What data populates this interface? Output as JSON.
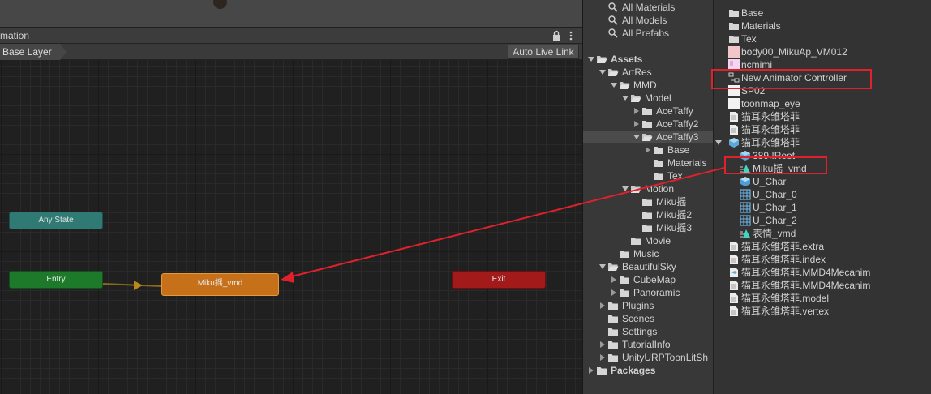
{
  "animator": {
    "title": "mation",
    "layer": "Base Layer",
    "auto_live_link": "Auto Live Link",
    "nodes": {
      "any_state": "Any State",
      "entry": "Entry",
      "motion_state": "Miku摇_vmd",
      "exit": "Exit"
    }
  },
  "project": {
    "searches": [
      "All Materials",
      "All Models",
      "All Prefabs"
    ],
    "tree": {
      "assets": "Assets",
      "artres": "ArtRes",
      "mmd": "MMD",
      "model": "Model",
      "acetaffy": "AceTaffy",
      "acetaffy2": "AceTaffy2",
      "acetaffy3": "AceTaffy3",
      "base": "Base",
      "materials": "Materials",
      "tex": "Tex",
      "motion": "Motion",
      "miku1": "Miku摇",
      "miku2": "Miku摇2",
      "miku3": "Miku摇3",
      "movie": "Movie",
      "music": "Music",
      "beautifulsky": "BeautifulSky",
      "cubemap": "CubeMap",
      "panoramic": "Panoramic",
      "plugins": "Plugins",
      "scenes": "Scenes",
      "settings": "Settings",
      "tutorialinfo": "TutorialInfo",
      "unityurp": "UnityURPToonLitSh",
      "packages": "Packages"
    },
    "assets": [
      "Base",
      "Materials",
      "Tex",
      "body00_MikuAp_VM012",
      "ncmimi",
      "New Animator Controller",
      "SP02",
      "toonmap_eye",
      "猫耳永雏塔菲",
      "猫耳永雏塔菲",
      "猫耳永雏塔菲",
      "389.!Root",
      "Miku摇_vmd",
      "U_Char",
      "U_Char_0",
      "U_Char_1",
      "U_Char_2",
      "表情_vmd",
      "猫耳永雏塔菲.extra",
      "猫耳永雏塔菲.index",
      "猫耳永雏塔菲.MMD4Mecanim",
      "猫耳永雏塔菲.MMD4Mecanim",
      "猫耳永雏塔菲.model",
      "猫耳永雏塔菲.vertex"
    ]
  },
  "colors": {
    "annotation": "#e0202a",
    "any_state": "#2f7a72",
    "entry": "#1d7a2a",
    "motion_state": "#c6701a",
    "exit": "#a31a1a"
  }
}
